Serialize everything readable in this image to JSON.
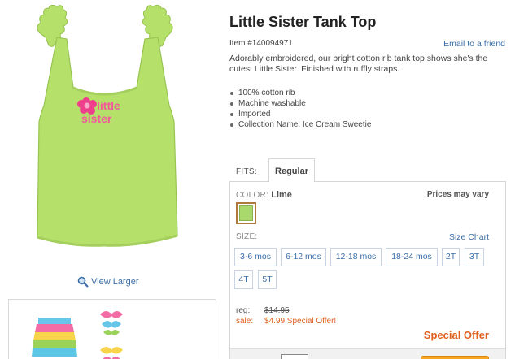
{
  "product": {
    "title": "Little Sister Tank Top",
    "item_number": "Item #140094971",
    "email_link": "Email to a friend",
    "description": "Adorably embroidered, our bright cotton rib tank top shows she's the cutest Little Sister. Finished with ruffly straps.",
    "features": [
      "100% cotton rib",
      "Machine washable",
      "Imported",
      "Collection Name: Ice Cream Sweetie"
    ],
    "embroidery_line1": "little",
    "embroidery_line2": "sister",
    "image_color": "#b5e06a",
    "view_larger": "View Larger"
  },
  "fits": {
    "label": "FITS:",
    "tabs": [
      {
        "label": "Regular",
        "selected": true
      }
    ]
  },
  "options": {
    "color_label": "COLOR:",
    "color_value": "Lime",
    "prices_note": "Prices may vary",
    "swatch_color": "#a9d86c",
    "size_label": "SIZE:",
    "size_chart_link": "Size Chart",
    "sizes": [
      "3-6 mos",
      "6-12 mos",
      "12-18 mos",
      "18-24 mos",
      "2T",
      "3T",
      "4T",
      "5T"
    ]
  },
  "pricing": {
    "reg_label": "reg:",
    "reg_price": "$14.95",
    "sale_label": "sale:",
    "sale_price": "$4.99 Special Offer!",
    "special_offer": "Special Offer"
  },
  "colors": {
    "link": "#3b6ea5",
    "sale": "#e0611f",
    "add_button": "#f6a623"
  }
}
